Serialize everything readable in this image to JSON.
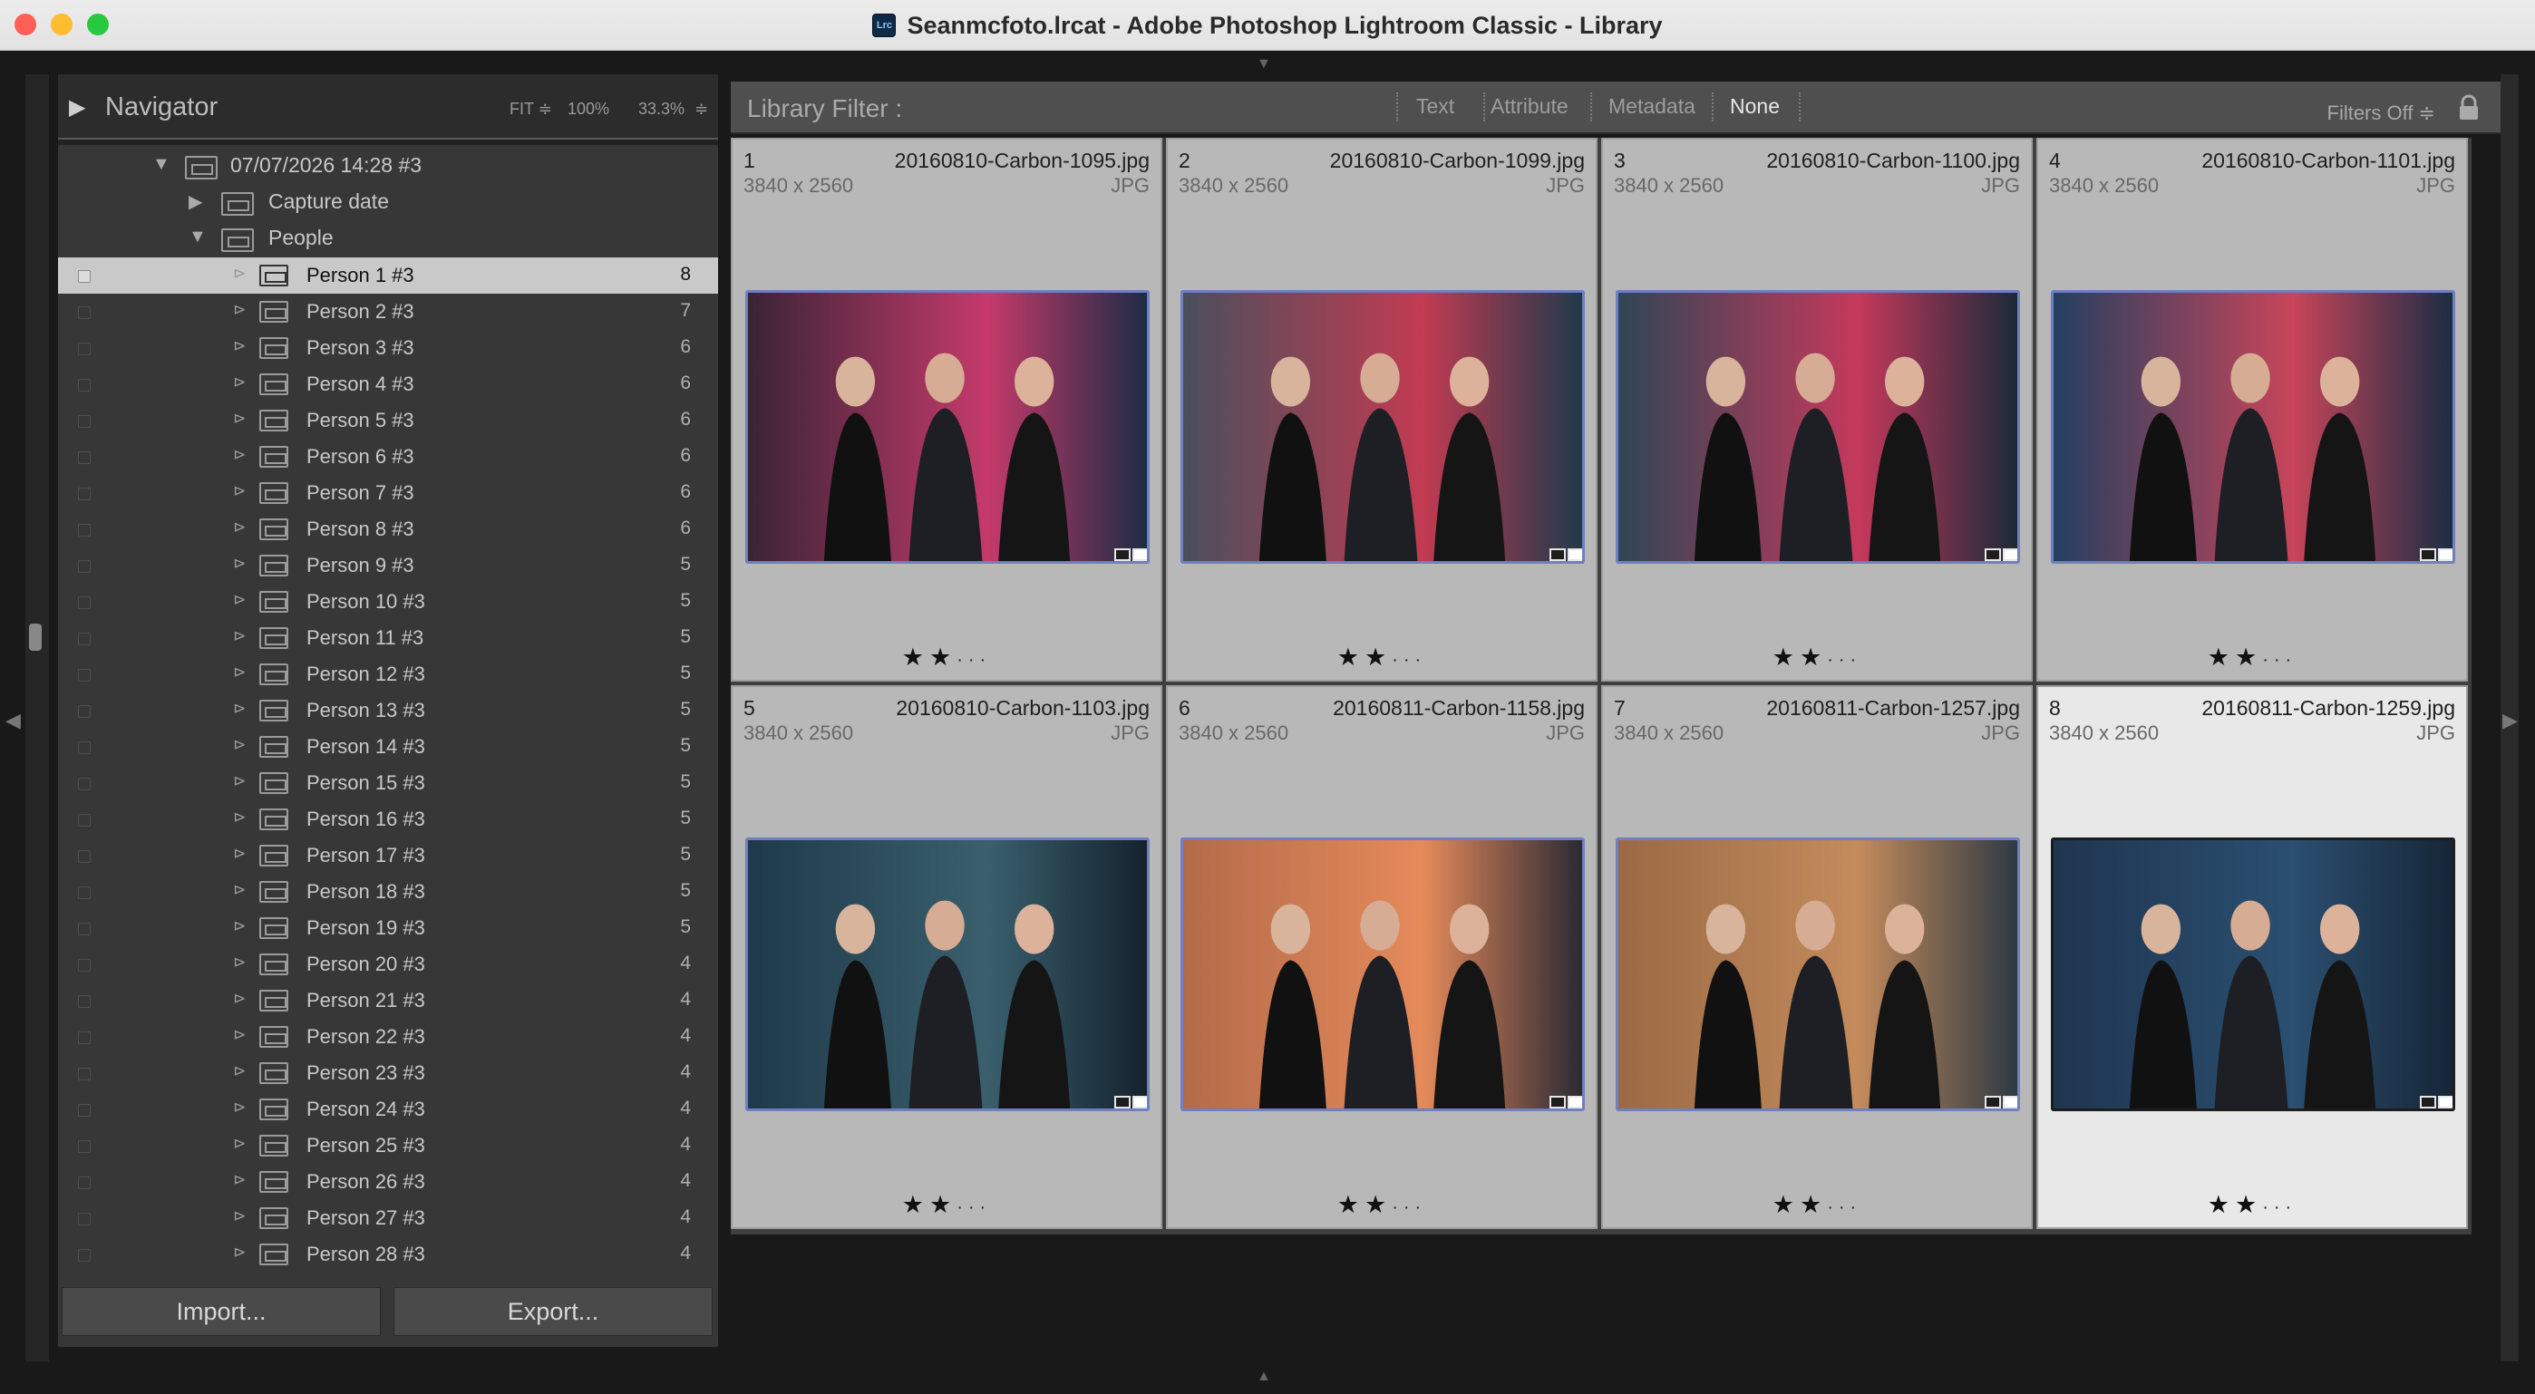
{
  "window": {
    "title": "Seanmcfoto.lrcat - Adobe Photoshop Lightroom Classic - Library",
    "icon_text": "Lrc"
  },
  "navigator": {
    "title": "Navigator",
    "zoom_fit": "FIT ≑",
    "zoom_100": "100%",
    "zoom_333": "33.3%",
    "zoom_arrow": "≑"
  },
  "folders": {
    "date_folder": "07/07/2026 14:28 #3",
    "capture_date": "Capture date",
    "people": "People"
  },
  "people": [
    {
      "label": "Person 1 #3",
      "count": "8"
    },
    {
      "label": "Person 2 #3",
      "count": "7"
    },
    {
      "label": "Person 3 #3",
      "count": "6"
    },
    {
      "label": "Person 4 #3",
      "count": "6"
    },
    {
      "label": "Person 5 #3",
      "count": "6"
    },
    {
      "label": "Person 6 #3",
      "count": "6"
    },
    {
      "label": "Person 7 #3",
      "count": "6"
    },
    {
      "label": "Person 8 #3",
      "count": "6"
    },
    {
      "label": "Person 9 #3",
      "count": "5"
    },
    {
      "label": "Person 10 #3",
      "count": "5"
    },
    {
      "label": "Person 11 #3",
      "count": "5"
    },
    {
      "label": "Person 12 #3",
      "count": "5"
    },
    {
      "label": "Person 13 #3",
      "count": "5"
    },
    {
      "label": "Person 14 #3",
      "count": "5"
    },
    {
      "label": "Person 15 #3",
      "count": "5"
    },
    {
      "label": "Person 16 #3",
      "count": "5"
    },
    {
      "label": "Person 17 #3",
      "count": "5"
    },
    {
      "label": "Person 18 #3",
      "count": "5"
    },
    {
      "label": "Person 19 #3",
      "count": "5"
    },
    {
      "label": "Person 20 #3",
      "count": "4"
    },
    {
      "label": "Person 21 #3",
      "count": "4"
    },
    {
      "label": "Person 22 #3",
      "count": "4"
    },
    {
      "label": "Person 23 #3",
      "count": "4"
    },
    {
      "label": "Person 24 #3",
      "count": "4"
    },
    {
      "label": "Person 25 #3",
      "count": "4"
    },
    {
      "label": "Person 26 #3",
      "count": "4"
    },
    {
      "label": "Person 27 #3",
      "count": "4"
    },
    {
      "label": "Person 28 #3",
      "count": "4"
    }
  ],
  "buttons": {
    "import": "Import...",
    "export": "Export..."
  },
  "filter": {
    "title": "Library Filter :",
    "text": "Text",
    "attribute": "Attribute",
    "metadata": "Metadata",
    "none": "None",
    "filters_off": "Filters Off ≑"
  },
  "photos": [
    {
      "num": "1",
      "name": "20160810-Carbon-1095.jpg",
      "dims": "3840 x 2560",
      "ext": "JPG",
      "rating": 2
    },
    {
      "num": "2",
      "name": "20160810-Carbon-1099.jpg",
      "dims": "3840 x 2560",
      "ext": "JPG",
      "rating": 2
    },
    {
      "num": "3",
      "name": "20160810-Carbon-1100.jpg",
      "dims": "3840 x 2560",
      "ext": "JPG",
      "rating": 2
    },
    {
      "num": "4",
      "name": "20160810-Carbon-1101.jpg",
      "dims": "3840 x 2560",
      "ext": "JPG",
      "rating": 2
    },
    {
      "num": "5",
      "name": "20160810-Carbon-1103.jpg",
      "dims": "3840 x 2560",
      "ext": "JPG",
      "rating": 2
    },
    {
      "num": "6",
      "name": "20160811-Carbon-1158.jpg",
      "dims": "3840 x 2560",
      "ext": "JPG",
      "rating": 2
    },
    {
      "num": "7",
      "name": "20160811-Carbon-1257.jpg",
      "dims": "3840 x 2560",
      "ext": "JPG",
      "rating": 2
    },
    {
      "num": "8",
      "name": "20160811-Carbon-1259.jpg",
      "dims": "3840 x 2560",
      "ext": "JPG",
      "rating": 2
    }
  ],
  "colors": {
    "selection_border": "#6f7fc1",
    "selected_cell": "#e8e8e8",
    "cell": "#b8b8b8"
  }
}
